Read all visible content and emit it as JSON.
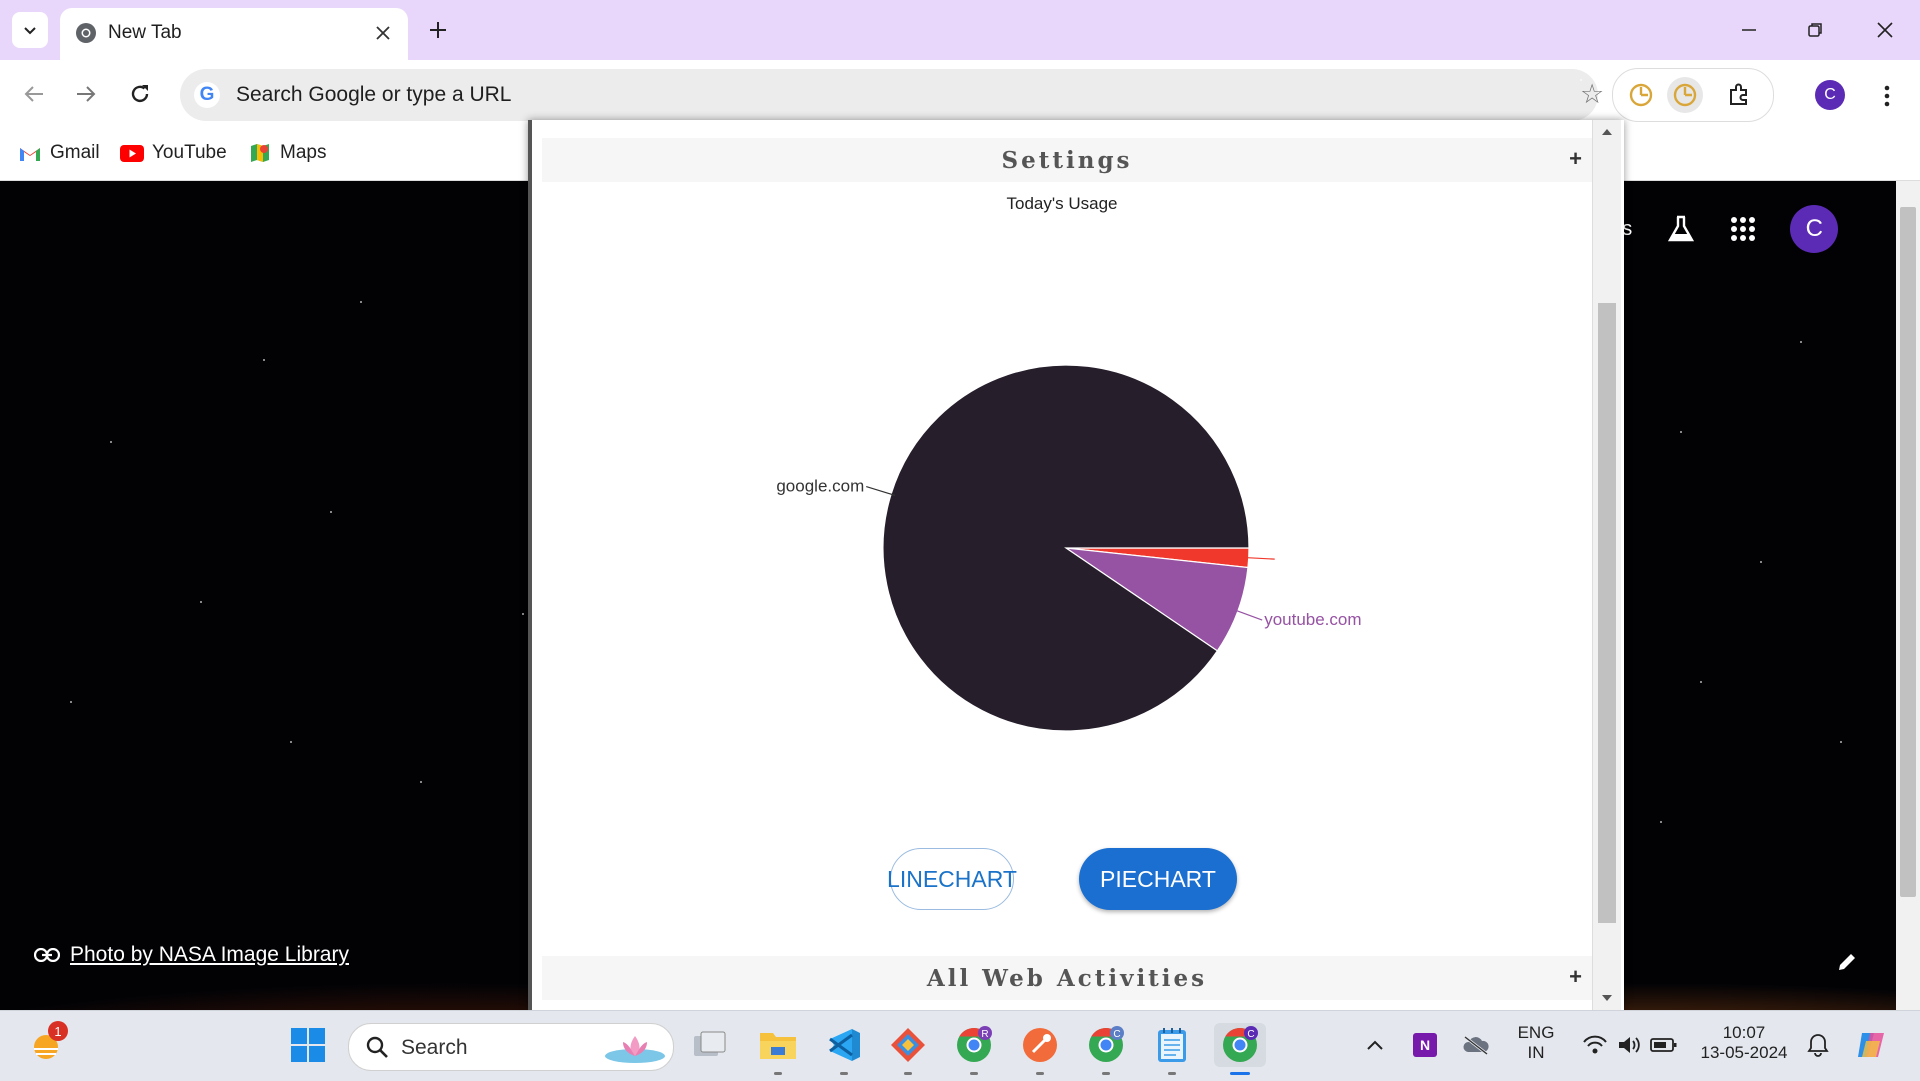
{
  "browser": {
    "tab_title": "New Tab",
    "omnibox_placeholder": "Search Google or type a URL",
    "profile_initial": "C"
  },
  "bookmarks": [
    {
      "label": "Gmail",
      "icon": "gmail-icon"
    },
    {
      "label": "YouTube",
      "icon": "youtube-icon"
    },
    {
      "label": "Maps",
      "icon": "maps-icon"
    }
  ],
  "ntp": {
    "images_link": "ges",
    "avatar_initial": "C",
    "photo_credit": "Photo by NASA Image Library"
  },
  "popup": {
    "settings_header": "Settings",
    "all_activities_header": "All Web Activities",
    "expand_symbol": "+",
    "linechart_label": "LINECHART",
    "piechart_label": "PIECHART"
  },
  "chart_data": {
    "type": "pie",
    "title": "Today's Usage",
    "slices": [
      {
        "label": "google.com",
        "value": 90.5,
        "color": "#261e2b"
      },
      {
        "label": "youtube.com",
        "value": 7.8,
        "color": "#9652a3"
      },
      {
        "label": "",
        "value": 1.7,
        "color": "#f0382c"
      }
    ]
  },
  "taskbar": {
    "search_label": "Search",
    "weather_badge": "1",
    "language_line1": "ENG",
    "language_line2": "IN",
    "time": "10:07",
    "date": "13-05-2024"
  }
}
